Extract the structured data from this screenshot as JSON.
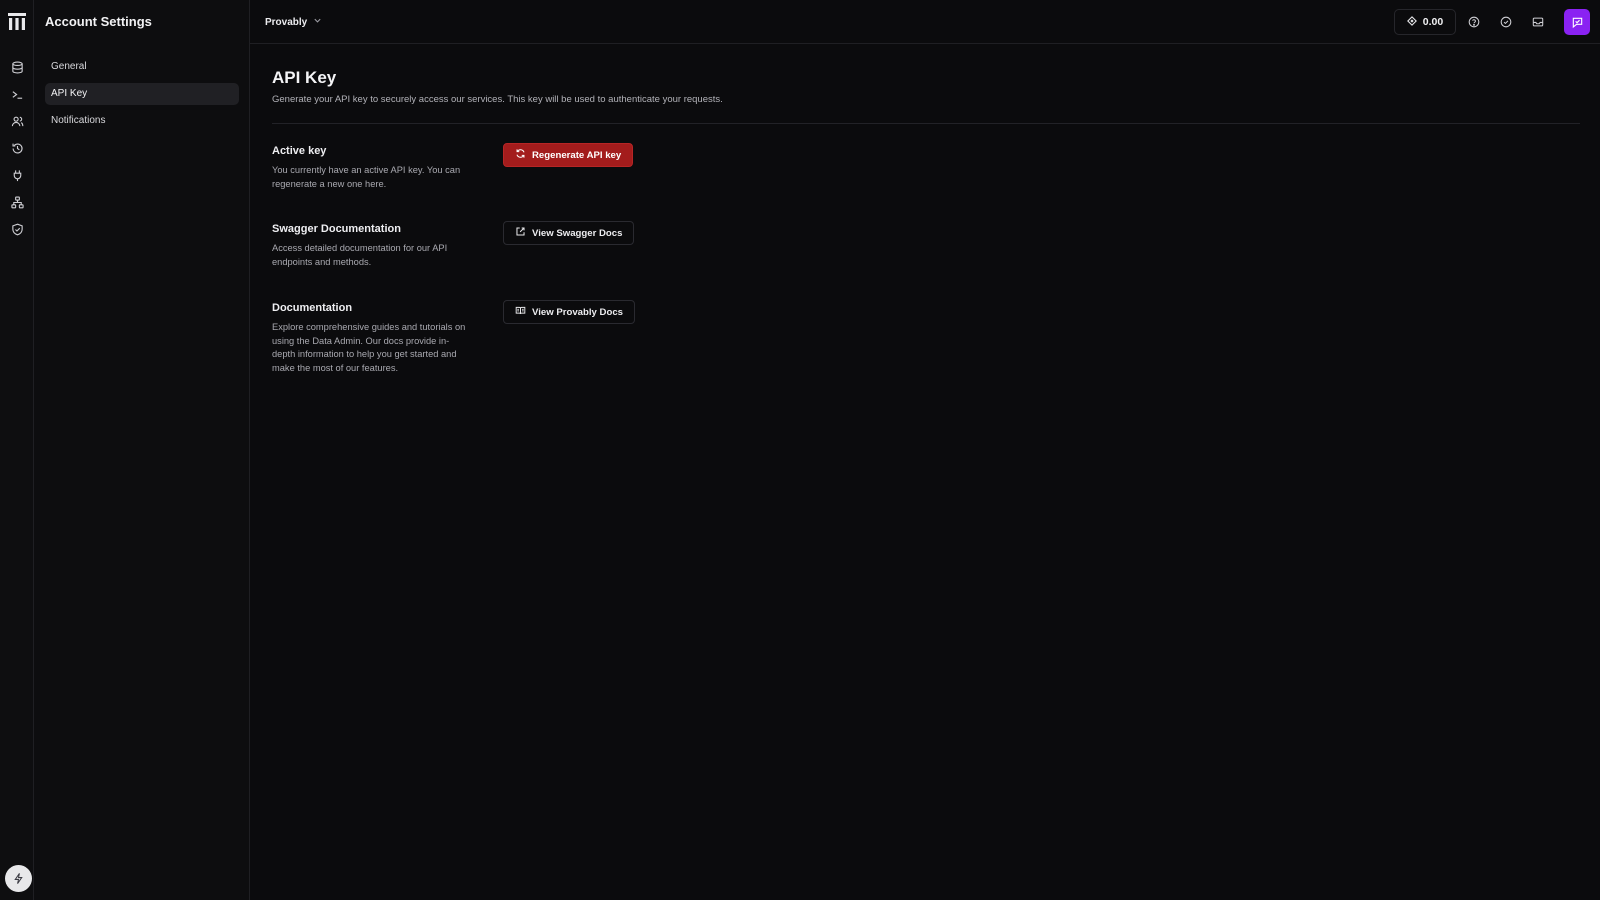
{
  "sidebar": {
    "title": "Account Settings",
    "items": [
      {
        "label": "General",
        "active": false
      },
      {
        "label": "API Key",
        "active": true
      },
      {
        "label": "Notifications",
        "active": false
      }
    ]
  },
  "rail": {
    "icons": [
      "database-icon",
      "terminal-icon",
      "users-icon",
      "history-icon",
      "plug-icon",
      "network-icon",
      "shield-icon"
    ],
    "bottom_icon": "bolt-icon"
  },
  "topbar": {
    "workspace": "Provably",
    "balance": "0.00",
    "icons": [
      "help-icon",
      "check-circle-icon",
      "inbox-icon",
      "feedback-icon"
    ]
  },
  "main": {
    "title": "API Key",
    "description": "Generate your API key to securely access our services. This key will be used to authenticate your requests.",
    "sections": [
      {
        "title": "Active key",
        "description": "You currently have an active API key. You can regenerate a new one here.",
        "button": "Regenerate API key"
      },
      {
        "title": "Swagger Documentation",
        "description": "Access detailed documentation for our API endpoints and methods.",
        "button": "View Swagger Docs"
      },
      {
        "title": "Documentation",
        "description": "Explore comprehensive guides and tutorials on using the Data Admin. Our docs provide in-depth information to help you get started and make the most of our features.",
        "button": "View Provably Docs"
      }
    ]
  },
  "colors": {
    "background": "#0b0b0d",
    "danger": "#a31c1c",
    "accent": "#8a22f2"
  }
}
